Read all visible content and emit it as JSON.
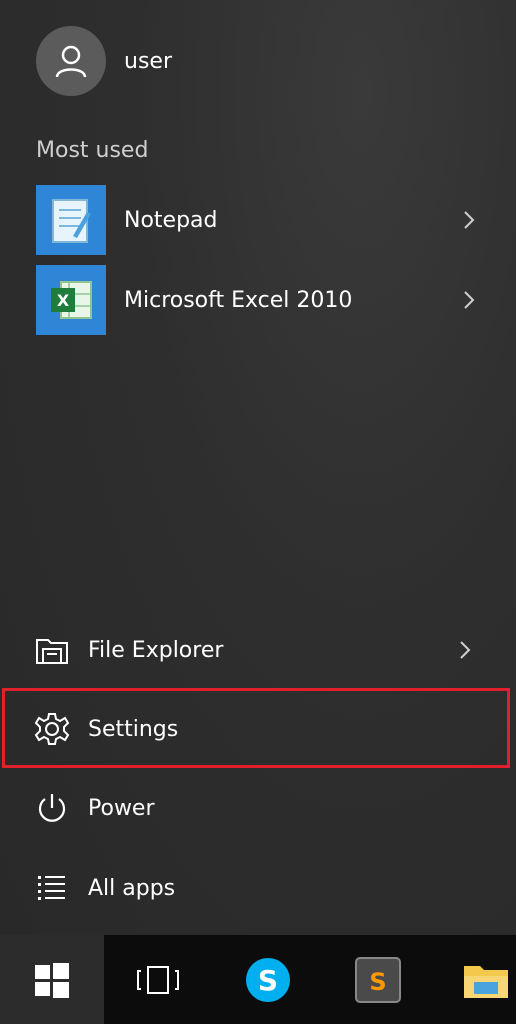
{
  "user": {
    "name": "user"
  },
  "most_used": {
    "label": "Most used",
    "apps": [
      {
        "label": "Notepad",
        "icon": "notepad-icon"
      },
      {
        "label": "Microsoft Excel 2010",
        "icon": "excel-icon"
      }
    ]
  },
  "bottom": [
    {
      "label": "File Explorer",
      "icon": "file-explorer-icon"
    },
    {
      "label": "Settings",
      "icon": "gear-icon"
    },
    {
      "label": "Power",
      "icon": "power-icon"
    },
    {
      "label": "All apps",
      "icon": "all-apps-icon"
    }
  ],
  "taskbar": {
    "items": [
      "windows-start-icon",
      "task-view-icon",
      "skype-icon",
      "sublime-text-icon",
      "file-explorer-icon"
    ]
  },
  "colors": {
    "highlight": "#e0202a",
    "tile": "#2f86d6",
    "taskbar": "#0c0c0c"
  }
}
